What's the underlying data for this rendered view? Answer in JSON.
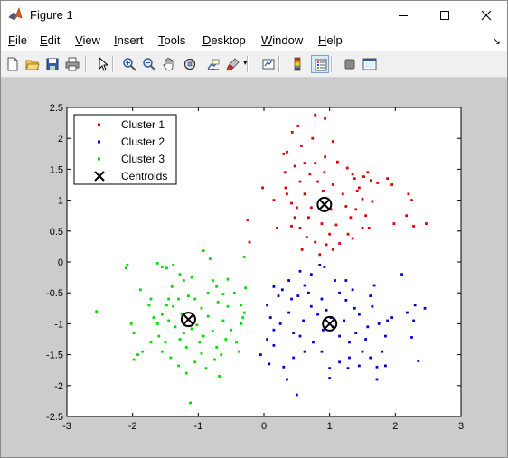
{
  "window": {
    "title": "Figure 1"
  },
  "menu": [
    {
      "label": "File",
      "u": "F",
      "rest": "ile"
    },
    {
      "label": "Edit",
      "u": "E",
      "rest": "dit"
    },
    {
      "label": "View",
      "u": "V",
      "rest": "iew"
    },
    {
      "label": "Insert",
      "u": "I",
      "rest": "nsert"
    },
    {
      "label": "Tools",
      "u": "T",
      "rest": "ools"
    },
    {
      "label": "Desktop",
      "u": "D",
      "rest": "esktop"
    },
    {
      "label": "Window",
      "u": "W",
      "rest": "indow"
    },
    {
      "label": "Help",
      "u": "H",
      "rest": "elp"
    }
  ],
  "toolbar": [
    "new-figure-icon",
    "open-file-icon",
    "save-icon",
    "print-icon",
    "edit-plot-arrow-icon",
    "zoom-in-icon",
    "zoom-out-icon",
    "pan-hand-icon",
    "rotate-3d-icon",
    "data-cursor-icon",
    "brush-icon",
    "link-plot-icon",
    "insert-colorbar-icon",
    "insert-legend-icon",
    "hide-plot-tools-icon",
    "show-plot-tools-icon"
  ],
  "colors": {
    "cluster1": "#dd0000",
    "cluster2": "#0000cc",
    "cluster3": "#00dd00",
    "centroid": "#000000"
  },
  "chart_data": {
    "type": "scatter",
    "xlim": [
      -3,
      3
    ],
    "ylim": [
      -2.5,
      2.5
    ],
    "xticks": [
      -3,
      -2,
      -1,
      0,
      1,
      2,
      3
    ],
    "yticks": [
      -2.5,
      -2,
      -1.5,
      -1,
      -0.5,
      0,
      0.5,
      1,
      1.5,
      2,
      2.5
    ],
    "xtick_labels": [
      "-3",
      "-2",
      "-1",
      "0",
      "1",
      "2",
      "3"
    ],
    "ytick_labels": [
      "-2.5",
      "-2",
      "-1.5",
      "-1",
      "-0.5",
      "0",
      "0.5",
      "1",
      "1.5",
      "2",
      "2.5"
    ],
    "legend": {
      "placement": "top-left",
      "entries": [
        "Cluster 1",
        "Cluster 2",
        "Cluster 3",
        "Centroids"
      ]
    },
    "series": [
      {
        "name": "Cluster 1",
        "color": "#dd0000",
        "points": [
          [
            0.78,
            2.38
          ],
          [
            0.93,
            2.32
          ],
          [
            0.52,
            2.2
          ],
          [
            0.43,
            2.1
          ],
          [
            0.74,
            2.0
          ],
          [
            0.57,
            1.88
          ],
          [
            1.05,
            1.95
          ],
          [
            0.35,
            1.78
          ],
          [
            0.47,
            1.55
          ],
          [
            0.62,
            1.6
          ],
          [
            0.78,
            1.6
          ],
          [
            0.93,
            1.7
          ],
          [
            1.12,
            1.62
          ],
          [
            1.27,
            1.52
          ],
          [
            1.38,
            1.35
          ],
          [
            1.45,
            1.2
          ],
          [
            1.52,
            1.38
          ],
          [
            1.58,
            1.45
          ],
          [
            1.5,
            1.02
          ],
          [
            1.42,
            1.15
          ],
          [
            1.35,
            1.42
          ],
          [
            1.63,
            1.32
          ],
          [
            1.73,
            1.28
          ],
          [
            1.88,
            1.35
          ],
          [
            1.95,
            1.25
          ],
          [
            1.98,
            0.62
          ],
          [
            2.17,
            0.75
          ],
          [
            2.2,
            1.1
          ],
          [
            2.25,
            1.0
          ],
          [
            2.28,
            0.58
          ],
          [
            2.47,
            0.62
          ],
          [
            0.3,
            1.75
          ],
          [
            0.32,
            1.45
          ],
          [
            0.33,
            1.2
          ],
          [
            0.35,
            1.1
          ],
          [
            0.42,
            0.95
          ],
          [
            0.47,
            0.72
          ],
          [
            0.55,
            0.55
          ],
          [
            0.65,
            0.4
          ],
          [
            0.78,
            0.32
          ],
          [
            0.85,
            0.12
          ],
          [
            0.95,
            0.28
          ],
          [
            1.05,
            0.2
          ],
          [
            1.15,
            0.3
          ],
          [
            1.28,
            0.45
          ],
          [
            1.32,
            0.72
          ],
          [
            1.4,
            0.85
          ],
          [
            1.55,
            0.75
          ],
          [
            1.6,
            0.55
          ],
          [
            1.65,
            0.98
          ],
          [
            0.62,
            1.1
          ],
          [
            0.72,
            0.88
          ],
          [
            0.88,
            0.62
          ],
          [
            1.0,
            0.45
          ],
          [
            1.1,
            0.6
          ],
          [
            1.25,
            0.9
          ],
          [
            1.05,
            1.25
          ],
          [
            0.82,
            1.3
          ],
          [
            0.7,
            1.42
          ],
          [
            0.92,
            1.45
          ],
          [
            1.2,
            1.1
          ],
          [
            1.35,
            0.38
          ],
          [
            0.5,
            0.88
          ],
          [
            0.2,
            0.55
          ],
          [
            0.55,
            1.3
          ],
          [
            0.68,
            0.72
          ],
          [
            0.15,
            1.0
          ],
          [
            -0.02,
            1.2
          ],
          [
            -0.25,
            0.68
          ],
          [
            -0.22,
            0.32
          ],
          [
            0.42,
            0.58
          ],
          [
            0.58,
            0.2
          ],
          [
            1.5,
            0.55
          ],
          [
            0.9,
            1.15
          ],
          [
            1.02,
            0.85
          ]
        ]
      },
      {
        "name": "Cluster 2",
        "color": "#0000cc",
        "points": [
          [
            0.85,
            -0.05
          ],
          [
            0.92,
            -0.08
          ],
          [
            1.08,
            -0.3
          ],
          [
            0.72,
            -0.2
          ],
          [
            0.55,
            -0.15
          ],
          [
            0.38,
            -0.3
          ],
          [
            0.28,
            -0.45
          ],
          [
            0.15,
            -0.4
          ],
          [
            0.52,
            -0.55
          ],
          [
            0.62,
            -0.38
          ],
          [
            0.88,
            -0.6
          ],
          [
            1.15,
            -0.5
          ],
          [
            1.25,
            -0.62
          ],
          [
            1.35,
            -0.45
          ],
          [
            1.62,
            -0.55
          ],
          [
            1.68,
            -0.38
          ],
          [
            1.65,
            -0.72
          ],
          [
            1.75,
            -1.0
          ],
          [
            1.88,
            -0.95
          ],
          [
            1.95,
            -0.9
          ],
          [
            2.18,
            -0.82
          ],
          [
            2.28,
            -0.95
          ],
          [
            2.25,
            -1.22
          ],
          [
            2.35,
            -1.6
          ],
          [
            2.1,
            -0.2
          ],
          [
            2.45,
            -0.75
          ],
          [
            2.3,
            -0.7
          ],
          [
            0.05,
            -0.7
          ],
          [
            0.1,
            -0.9
          ],
          [
            0.15,
            -1.1
          ],
          [
            0.25,
            -1.0
          ],
          [
            0.38,
            -0.82
          ],
          [
            0.45,
            -1.15
          ],
          [
            0.55,
            -1.2
          ],
          [
            0.6,
            -0.95
          ],
          [
            0.72,
            -0.72
          ],
          [
            0.82,
            -0.85
          ],
          [
            0.95,
            -0.78
          ],
          [
            1.05,
            -1.05
          ],
          [
            1.15,
            -1.2
          ],
          [
            1.22,
            -0.95
          ],
          [
            1.3,
            -1.3
          ],
          [
            1.4,
            -1.15
          ],
          [
            1.5,
            -1.45
          ],
          [
            1.55,
            -1.25
          ],
          [
            1.45,
            -0.85
          ],
          [
            1.62,
            -1.55
          ],
          [
            1.72,
            -1.7
          ],
          [
            1.8,
            -1.45
          ],
          [
            1.85,
            -1.2
          ],
          [
            1.3,
            -1.55
          ],
          [
            1.15,
            -1.62
          ],
          [
            1.0,
            -1.72
          ],
          [
            0.88,
            -1.45
          ],
          [
            0.75,
            -1.3
          ],
          [
            0.62,
            -1.45
          ],
          [
            0.45,
            -1.55
          ],
          [
            0.3,
            -1.7
          ],
          [
            0.15,
            -1.35
          ],
          [
            0.05,
            -1.25
          ],
          [
            -0.05,
            -1.5
          ],
          [
            0.08,
            -1.65
          ],
          [
            0.35,
            -1.9
          ],
          [
            0.5,
            -2.15
          ],
          [
            1.0,
            -1.88
          ],
          [
            1.28,
            -1.72
          ],
          [
            1.45,
            -1.68
          ],
          [
            1.72,
            -1.9
          ],
          [
            1.85,
            -1.68
          ],
          [
            0.68,
            -0.5
          ],
          [
            1.25,
            -0.3
          ],
          [
            1.02,
            -0.9
          ],
          [
            0.9,
            -1.1
          ],
          [
            1.58,
            -1.05
          ],
          [
            0.42,
            -0.6
          ],
          [
            0.22,
            -0.55
          ],
          [
            1.38,
            -0.75
          ]
        ]
      },
      {
        "name": "Cluster 3",
        "color": "#00dd00",
        "points": [
          [
            -2.55,
            -0.8
          ],
          [
            -2.1,
            -0.1
          ],
          [
            -2.08,
            -0.05
          ],
          [
            -1.88,
            -0.45
          ],
          [
            -1.72,
            -0.6
          ],
          [
            -1.62,
            -0.02
          ],
          [
            -1.55,
            -0.08
          ],
          [
            -1.48,
            -0.1
          ],
          [
            -1.38,
            -0.05
          ],
          [
            -1.45,
            -0.6
          ],
          [
            -1.38,
            -0.72
          ],
          [
            -1.28,
            -0.2
          ],
          [
            -1.22,
            -0.3
          ],
          [
            -1.1,
            -0.25
          ],
          [
            -0.92,
            0.18
          ],
          [
            -0.82,
            0.05
          ],
          [
            -0.78,
            -0.3
          ],
          [
            -0.72,
            -0.4
          ],
          [
            -0.62,
            -0.52
          ],
          [
            -0.55,
            -0.28
          ],
          [
            -0.45,
            -0.5
          ],
          [
            -0.35,
            -0.7
          ],
          [
            -0.32,
            -0.9
          ],
          [
            -0.28,
            -0.42
          ],
          [
            -0.3,
            -0.82
          ],
          [
            -0.3,
            0.08
          ],
          [
            -2.02,
            -1.0
          ],
          [
            -1.98,
            -1.15
          ],
          [
            -1.92,
            -1.5
          ],
          [
            -1.98,
            -1.58
          ],
          [
            -1.85,
            -1.45
          ],
          [
            -1.72,
            -1.3
          ],
          [
            -1.62,
            -1.0
          ],
          [
            -1.55,
            -0.85
          ],
          [
            -1.48,
            -0.7
          ],
          [
            -1.35,
            -1.05
          ],
          [
            -1.28,
            -1.25
          ],
          [
            -1.22,
            -1.15
          ],
          [
            -1.18,
            -1.38
          ],
          [
            -1.1,
            -1.08
          ],
          [
            -1.02,
            -1.02
          ],
          [
            -0.98,
            -1.3
          ],
          [
            -0.92,
            -1.2
          ],
          [
            -0.85,
            -0.88
          ],
          [
            -0.78,
            -1.12
          ],
          [
            -0.72,
            -1.38
          ],
          [
            -0.65,
            -1.5
          ],
          [
            -0.58,
            -1.25
          ],
          [
            -0.5,
            -1.1
          ],
          [
            -0.42,
            -1.3
          ],
          [
            -0.38,
            -1.45
          ],
          [
            -0.35,
            -1.0
          ],
          [
            -1.55,
            -1.45
          ],
          [
            -1.42,
            -1.55
          ],
          [
            -1.3,
            -1.68
          ],
          [
            -1.18,
            -1.8
          ],
          [
            -1.05,
            -1.62
          ],
          [
            -0.95,
            -1.48
          ],
          [
            -0.88,
            -1.72
          ],
          [
            -0.75,
            -1.58
          ],
          [
            -0.68,
            -1.85
          ],
          [
            -1.12,
            -2.28
          ],
          [
            -1.75,
            -0.7
          ],
          [
            -1.68,
            -0.9
          ],
          [
            -1.6,
            -1.2
          ],
          [
            -1.5,
            -1.3
          ],
          [
            -1.45,
            -0.95
          ],
          [
            -1.4,
            -0.4
          ],
          [
            -1.3,
            -0.6
          ],
          [
            -1.25,
            -0.85
          ],
          [
            -1.05,
            -0.6
          ],
          [
            -0.95,
            -0.75
          ],
          [
            -0.85,
            -0.5
          ],
          [
            -0.62,
            -0.95
          ],
          [
            -0.55,
            -0.72
          ],
          [
            -1.15,
            -0.55
          ],
          [
            -0.7,
            -0.65
          ]
        ]
      }
    ],
    "centroids": [
      [
        0.92,
        0.93
      ],
      [
        1.0,
        -1.0
      ],
      [
        -1.15,
        -0.93
      ]
    ]
  }
}
